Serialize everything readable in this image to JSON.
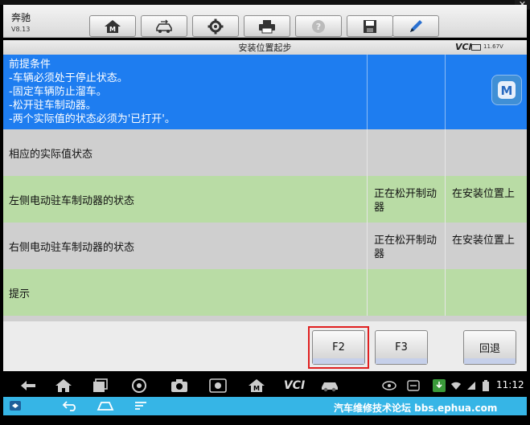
{
  "app": {
    "brand": "奔驰",
    "version": "V8.13",
    "close_symbol": "✕"
  },
  "toolbar": {
    "buttons": [
      {
        "icon": "home-m-icon"
      },
      {
        "icon": "car-swap-icon"
      },
      {
        "icon": "gear-icon"
      },
      {
        "icon": "printer-icon"
      },
      {
        "icon": "help-icon"
      },
      {
        "icon": "save-icon"
      },
      {
        "icon": "pen-icon"
      }
    ]
  },
  "subheader": {
    "title": "安装位置起步",
    "vci_label": "VCI",
    "battery_voltage": "11.67V"
  },
  "precondition": {
    "lines": [
      "前提条件",
      "-车辆必须处于停止状态。",
      "-固定车辆防止溜车。",
      "-松开驻车制动器。",
      "-两个实际值的状态必须为'已打开'。"
    ]
  },
  "rows": [
    {
      "label": "相应的实际值状态",
      "value1": "",
      "value2": ""
    },
    {
      "label": "左侧电动驻车制动器的状态",
      "value1": "正在松开制动器",
      "value2": "在安装位置上"
    },
    {
      "label": "右侧电动驻车制动器的状态",
      "value1": "正在松开制动器",
      "value2": "在安装位置上"
    },
    {
      "label": "提示",
      "value1": "",
      "value2": ""
    }
  ],
  "function_buttons": {
    "f2": "F2",
    "f3": "F3",
    "back": "回退"
  },
  "navbar": {
    "vci_label": "VCI",
    "time": "11:12"
  },
  "watermark": "汽车维修技术论坛 bbs.ephua.com",
  "colors": {
    "selection_blue": "#1e7df0",
    "row_gray": "#cfcfcf",
    "row_green": "#b9dca5",
    "highlight_red": "#e02020",
    "system_bar": "#36b5e6"
  }
}
